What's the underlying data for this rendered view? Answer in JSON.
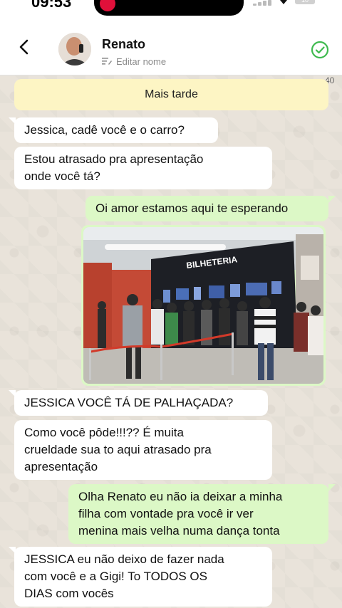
{
  "status_bar": {
    "time": "09:53",
    "battery": "10"
  },
  "header": {
    "back_label": "voltar",
    "contact_name": "Renato",
    "edit_name_label": "Editar nome"
  },
  "counter": "40",
  "note": "Mais tarde",
  "messages": [
    {
      "side": "in",
      "text": "Jessica, cadê você e o carro?"
    },
    {
      "side": "in",
      "lines": [
        "Estou atrasado pra apresentação",
        "onde você tá?"
      ]
    },
    {
      "side": "out",
      "text": "Oi amor estamos aqui te esperando"
    },
    {
      "side": "out",
      "image": "photo-cinema-ticket-booth",
      "sign": "BILHETERIA"
    },
    {
      "side": "in",
      "text": "JESSICA VOCÊ TÁ DE PALHAÇADA?"
    },
    {
      "side": "in",
      "lines": [
        "Como você pôde!!!?? É muita",
        "crueldade sua to aqui atrasado pra",
        "apresentação"
      ]
    },
    {
      "side": "out",
      "lines": [
        "Olha Renato eu não ia deixar a minha",
        "filha com vontade pra você ir ver",
        "menina mais velha numa dança tonta"
      ]
    },
    {
      "side": "in",
      "lines": [
        "JESSICA eu não deixo de fazer nada",
        "com você e a Gigi! To TODOS OS",
        "DIAS com vocês"
      ]
    }
  ],
  "colors": {
    "incoming": "#ffffff",
    "outgoing": "#dcf8c6",
    "note": "#fdf5c4",
    "check": "#3fba4f"
  }
}
